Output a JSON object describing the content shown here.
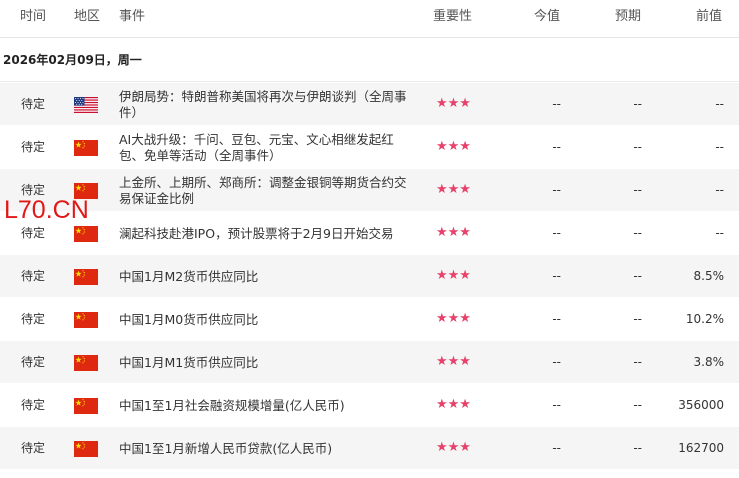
{
  "header": {
    "time": "时间",
    "region": "地区",
    "event": "事件",
    "importance": "重要性",
    "actual": "今值",
    "forecast": "预期",
    "previous": "前值"
  },
  "date_group": "2026年02月09日，周一",
  "watermark": "L70.CN",
  "colors": {
    "star": "#e8416b",
    "watermark": "#e01818",
    "row_alt": "#f5f5f5"
  },
  "events": [
    {
      "time": "待定",
      "flag": "us-flag-icon",
      "event": "伊朗局势：特朗普称美国将再次与伊朗谈判（全周事件）",
      "stars": "★★★",
      "actual": "--",
      "forecast": "--",
      "previous": "--"
    },
    {
      "time": "待定",
      "flag": "cn-flag-icon",
      "event": "AI大战升级：千问、豆包、元宝、文心相继发起红包、免单等活动（全周事件）",
      "stars": "★★★",
      "actual": "--",
      "forecast": "--",
      "previous": "--"
    },
    {
      "time": "待定",
      "flag": "cn-flag-icon",
      "event": "上金所、上期所、郑商所：调整金银铜等期货合约交易保证金比例",
      "stars": "★★★",
      "actual": "--",
      "forecast": "--",
      "previous": "--"
    },
    {
      "time": "待定",
      "flag": "cn-flag-icon",
      "event": "澜起科技赴港IPO，预计股票将于2月9日开始交易",
      "stars": "★★★",
      "actual": "--",
      "forecast": "--",
      "previous": "--"
    },
    {
      "time": "待定",
      "flag": "cn-flag-icon",
      "event": "中国1月M2货币供应同比",
      "stars": "★★★",
      "actual": "--",
      "forecast": "--",
      "previous": "8.5%"
    },
    {
      "time": "待定",
      "flag": "cn-flag-icon",
      "event": "中国1月M0货币供应同比",
      "stars": "★★★",
      "actual": "--",
      "forecast": "--",
      "previous": "10.2%"
    },
    {
      "time": "待定",
      "flag": "cn-flag-icon",
      "event": "中国1月M1货币供应同比",
      "stars": "★★★",
      "actual": "--",
      "forecast": "--",
      "previous": "3.8%"
    },
    {
      "time": "待定",
      "flag": "cn-flag-icon",
      "event": "中国1至1月社会融资规模增量(亿人民币)",
      "stars": "★★★",
      "actual": "--",
      "forecast": "--",
      "previous": "356000"
    },
    {
      "time": "待定",
      "flag": "cn-flag-icon",
      "event": "中国1至1月新增人民币贷款(亿人民币)",
      "stars": "★★★",
      "actual": "--",
      "forecast": "--",
      "previous": "162700"
    }
  ]
}
